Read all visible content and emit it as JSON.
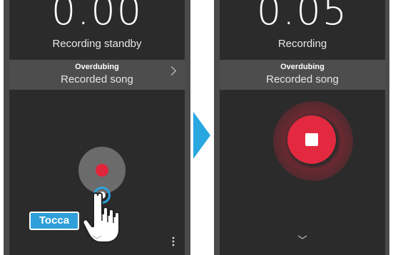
{
  "left_panel": {
    "time": "0.00",
    "status": "Recording standby",
    "band_title": "Overdubing",
    "band_song": "Recorded song",
    "callout": "Tocca"
  },
  "right_panel": {
    "time": "0.05",
    "status": "Recording",
    "band_title": "Overdubing",
    "band_song": "Recorded song"
  },
  "colors": {
    "record_red": "#e0253b",
    "callout_blue": "#2f9fd9",
    "screen_bg": "#2b2b2b",
    "band_bg": "#4d4d4d"
  },
  "icons": {
    "record": "record-dot-icon",
    "stop": "stop-square-icon",
    "chevron_right": "chevron-right-icon",
    "chevron_down": "chevron-down-icon",
    "more": "more-vertical-icon",
    "hand": "pointing-hand-icon",
    "arrow": "arrow-right-icon"
  }
}
